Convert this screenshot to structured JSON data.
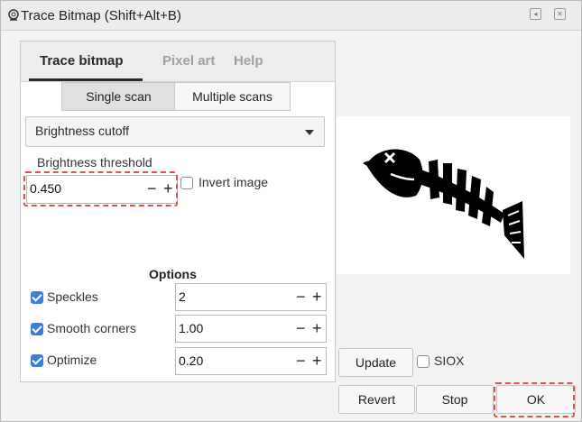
{
  "window": {
    "title": "Trace Bitmap (Shift+Alt+B)"
  },
  "tabs": [
    {
      "label": "Trace bitmap",
      "active": true
    },
    {
      "label": "Pixel art",
      "active": false
    },
    {
      "label": "Help",
      "active": false
    }
  ],
  "scan_mode": {
    "single_label": "Single scan",
    "multiple_label": "Multiple scans",
    "selected": "single"
  },
  "detection_mode": {
    "selected": "Brightness cutoff"
  },
  "threshold": {
    "label": "Brightness threshold",
    "value": "0.450",
    "minus": "−",
    "plus": "+"
  },
  "invert": {
    "label": "Invert image",
    "checked": false
  },
  "options": {
    "title": "Options",
    "rows": [
      {
        "label": "Speckles",
        "checked": true,
        "value": "2"
      },
      {
        "label": "Smooth corners",
        "checked": true,
        "value": "1.00"
      },
      {
        "label": "Optimize",
        "checked": true,
        "value": "0.20"
      }
    ]
  },
  "preview_actions": {
    "update_label": "Update",
    "siox_label": "SIOX",
    "siox_checked": false
  },
  "buttons": {
    "revert": "Revert",
    "stop": "Stop",
    "ok": "OK"
  },
  "icons": {
    "title": "trace-bitmap-icon",
    "preview": "fish-skeleton-icon"
  },
  "colors": {
    "check_accent": "#3b7dd8",
    "highlight_dash": "#d9534f"
  }
}
